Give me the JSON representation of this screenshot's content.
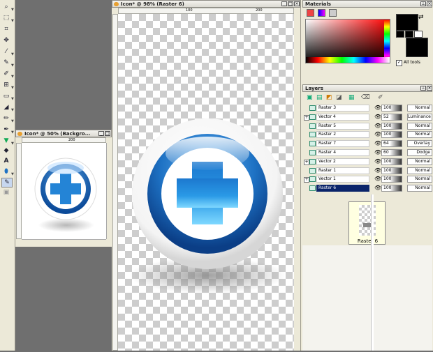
{
  "toolbar": {
    "tools": [
      "zoom-icon",
      "selection-icon",
      "crop-icon",
      "move-icon",
      "dropper-icon",
      "pen-icon",
      "brush-icon",
      "clone-icon",
      "shape-icon",
      "fill-icon",
      "paint-icon",
      "retouch-icon",
      "eraser-icon",
      "text-icon",
      "vector-icon",
      "draw-icon",
      "picture-tube-icon"
    ],
    "text_tool_glyph": "A"
  },
  "small_window": {
    "title": "Icon* @ 50% (Backgro...",
    "ruler_label": "200"
  },
  "main_window": {
    "title": "Icon* @ 98% (Raster 6)",
    "ruler_labels": [
      "100",
      "200"
    ]
  },
  "materials": {
    "title": "Materials",
    "all_tools_label": "All tools"
  },
  "layers": {
    "title": "Layers",
    "rows": [
      {
        "name": "Raster 3",
        "opacity": "100",
        "blend": "Normal",
        "group": false,
        "selected": false
      },
      {
        "name": "Vector 4",
        "opacity": "52",
        "blend": "Luminance",
        "group": true,
        "selected": false
      },
      {
        "name": "Raster 5",
        "opacity": "100",
        "blend": "Normal",
        "group": false,
        "selected": false
      },
      {
        "name": "Raster 2",
        "opacity": "100",
        "blend": "Normal",
        "group": false,
        "selected": false
      },
      {
        "name": "Raster 7",
        "opacity": "64",
        "blend": "Overlay",
        "group": false,
        "selected": false
      },
      {
        "name": "Raster 4",
        "opacity": "60",
        "blend": "Dodge",
        "group": false,
        "selected": false
      },
      {
        "name": "Vector 2",
        "opacity": "100",
        "blend": "Normal",
        "group": true,
        "selected": false
      },
      {
        "name": "Raster 1",
        "opacity": "100",
        "blend": "Normal",
        "group": false,
        "selected": false
      },
      {
        "name": "Vector 1",
        "opacity": "100",
        "blend": "Normal",
        "group": true,
        "selected": false
      },
      {
        "name": "Raster 6",
        "opacity": "100",
        "blend": "Normal",
        "group": false,
        "selected": true
      }
    ],
    "tooltip_label": "Raster 6"
  },
  "colors": {
    "icon_blue": "#1e72c4",
    "icon_blue_dark": "#0b3e86",
    "cross_light": "#7fd8ff",
    "selection": "#0a246a"
  }
}
